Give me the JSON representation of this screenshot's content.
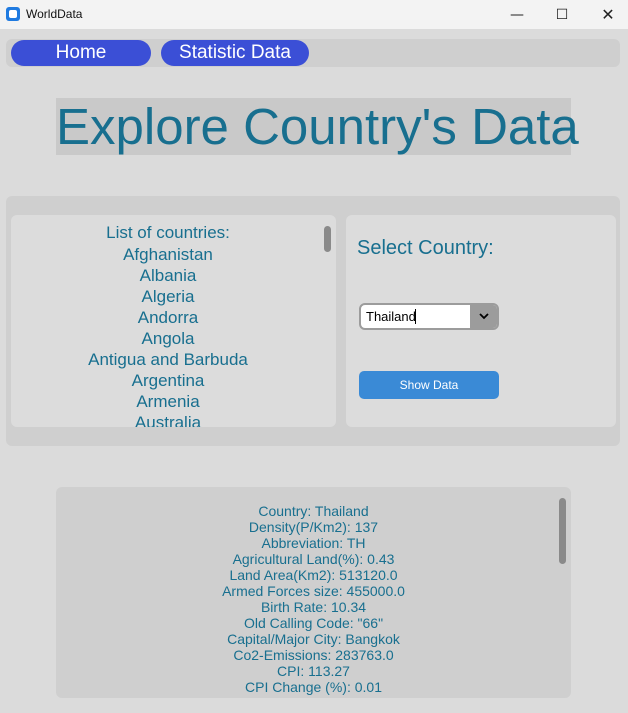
{
  "window": {
    "title": "WorldData",
    "minimize_glyph": "—",
    "maximize_glyph": "☐",
    "close_glyph": "✕"
  },
  "nav": {
    "home_label": "Home",
    "statistic_label": "Statistic Data"
  },
  "heading": "Explore Country's Data",
  "countries": {
    "header": "List of countries:",
    "items": [
      "Afghanistan",
      "Albania",
      "Algeria",
      "Andorra",
      "Angola",
      "Antigua and Barbuda",
      "Argentina",
      "Armenia",
      "Australia"
    ]
  },
  "selector": {
    "label": "Select Country:",
    "value": "Thailand",
    "button_label": "Show Data"
  },
  "result": {
    "lines": [
      "Country: Thailand",
      "Density(P/Km2): 137",
      "Abbreviation: TH",
      "Agricultural Land(%): 0.43",
      "Land Area(Km2): 513120.0",
      "Armed Forces size: 455000.0",
      "Birth Rate: 10.34",
      "Old Calling Code: \"66\"",
      "Capital/Major City: Bangkok",
      "Co2-Emissions: 283763.0",
      "CPI: 113.27",
      "CPI Change (%): 0.01"
    ]
  },
  "colors": {
    "accent_text": "#186f8f",
    "nav_button": "#3b4fd6",
    "show_button": "#3a8ad6"
  },
  "icons": {
    "app": "app-icon",
    "dropdown": "chevron-down-icon"
  }
}
